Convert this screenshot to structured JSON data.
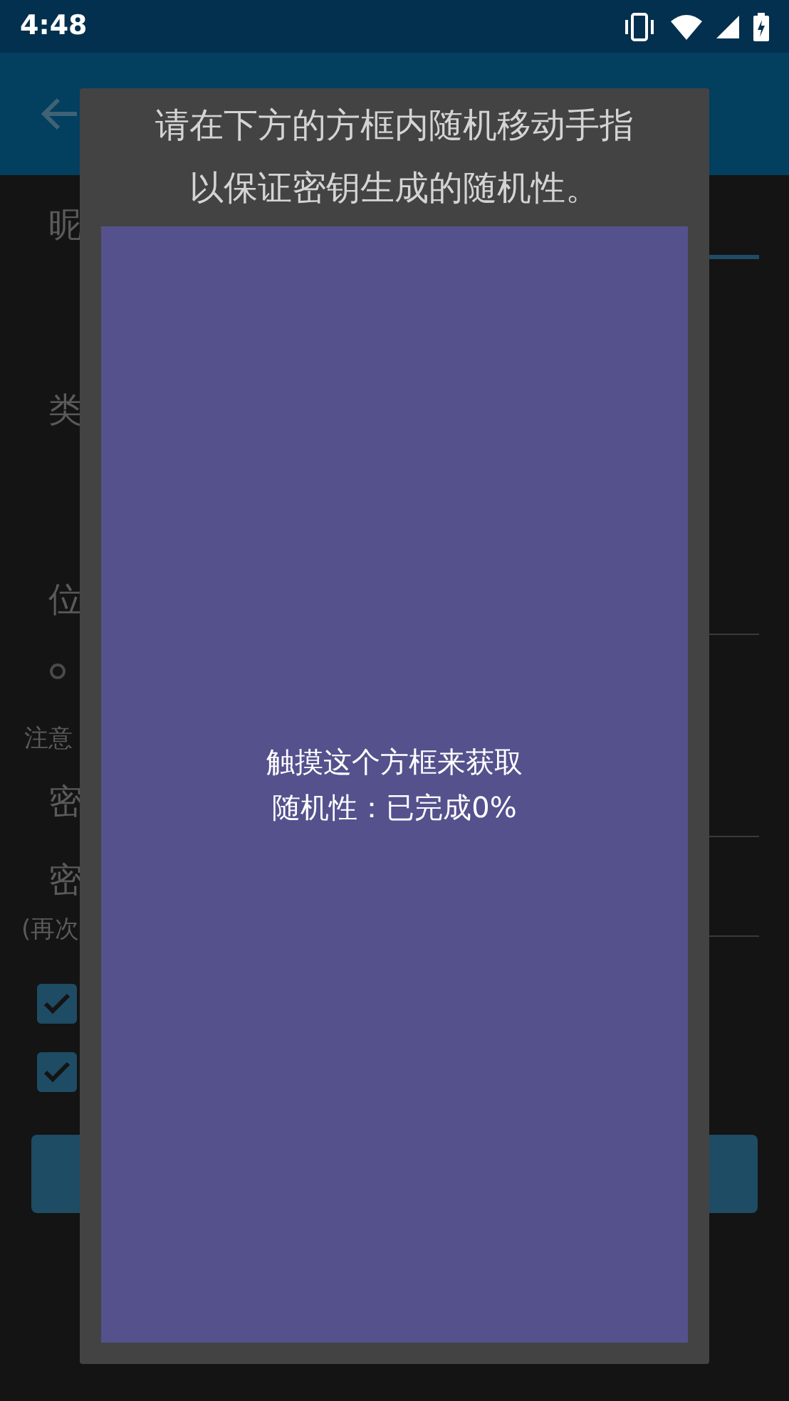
{
  "status_bar": {
    "time": "4:48"
  },
  "form": [
    {
      "kind": "label",
      "text": "昵"
    },
    {
      "kind": "label",
      "text": "类"
    },
    {
      "kind": "label",
      "text": "位"
    },
    {
      "kind": "note",
      "text": "注意"
    },
    {
      "kind": "label",
      "text": "密"
    },
    {
      "kind": "label",
      "text": "密"
    },
    {
      "kind": "hint",
      "text": "(再次"
    },
    {
      "kind": "checkbox",
      "checked": true
    },
    {
      "kind": "checkbox",
      "checked": true
    }
  ],
  "dialog": {
    "message_lines": [
      "请在下方的方框内随机移动手指",
      "以保证密钥生成的随机性。"
    ],
    "touch_area": {
      "lines": [
        "触摸这个方框来获取",
        "随机性：已完成0%"
      ]
    }
  }
}
